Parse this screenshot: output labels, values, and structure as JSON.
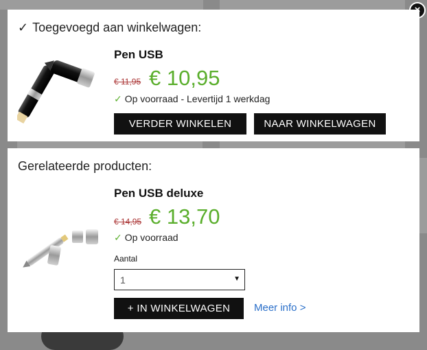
{
  "added_panel": {
    "heading": "Toegevoegd aan winkelwagen:",
    "check": "✓",
    "product": {
      "title": "Pen USB",
      "old_price": "€ 11,95",
      "new_price": "€ 10,95",
      "stock_tick": "✓",
      "stock_text": "Op voorraad - Levertijd 1 werkdag"
    },
    "continue_button": "VERDER WINKELEN",
    "cart_button": "NAAR WINKELWAGEN"
  },
  "related_panel": {
    "heading": "Gerelateerde producten:",
    "product": {
      "title": "Pen USB deluxe",
      "old_price": "€ 14,95",
      "new_price": "€ 13,70",
      "stock_tick": "✓",
      "stock_text": "Op voorraad"
    },
    "quantity_label": "Aantal",
    "quantity_value": "1",
    "add_button": "+ IN WINKELWAGEN",
    "more_info": "Meer info >"
  },
  "close_icon": "×",
  "colors": {
    "price_green": "#5aae2c",
    "old_price_red": "#a33333",
    "link_blue": "#2a6fc9",
    "button_black": "#111111"
  }
}
